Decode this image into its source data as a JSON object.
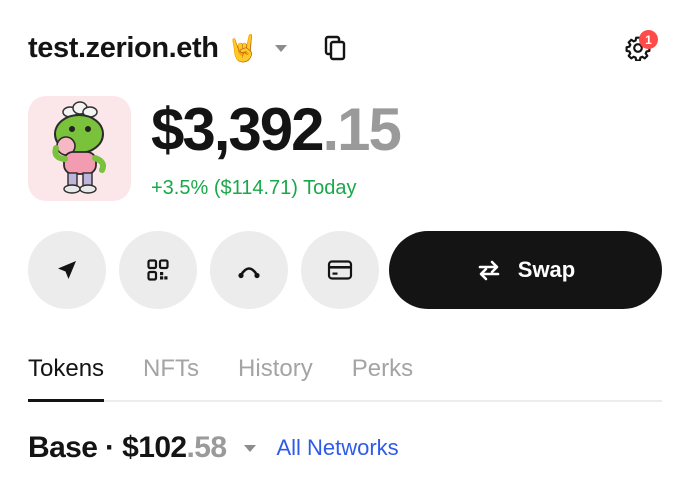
{
  "header": {
    "wallet_name": "test.zerion.eth",
    "emoji": "🤘",
    "notification_count": "1"
  },
  "portfolio": {
    "balance_main": "$3,392",
    "balance_cents": ".15",
    "change_text": "+3.5% ($114.71) Today",
    "change_color": "#1aa84a"
  },
  "actions": {
    "icons": [
      "send-icon",
      "qr-code-icon",
      "bridge-icon",
      "card-icon"
    ],
    "swap_label": "Swap"
  },
  "tabs": [
    {
      "label": "Tokens",
      "active": true
    },
    {
      "label": "NFTs",
      "active": false
    },
    {
      "label": "History",
      "active": false
    },
    {
      "label": "Perks",
      "active": false
    }
  ],
  "network": {
    "name_value": "Base · $102",
    "cents": ".58",
    "filter_label": "All Networks"
  }
}
